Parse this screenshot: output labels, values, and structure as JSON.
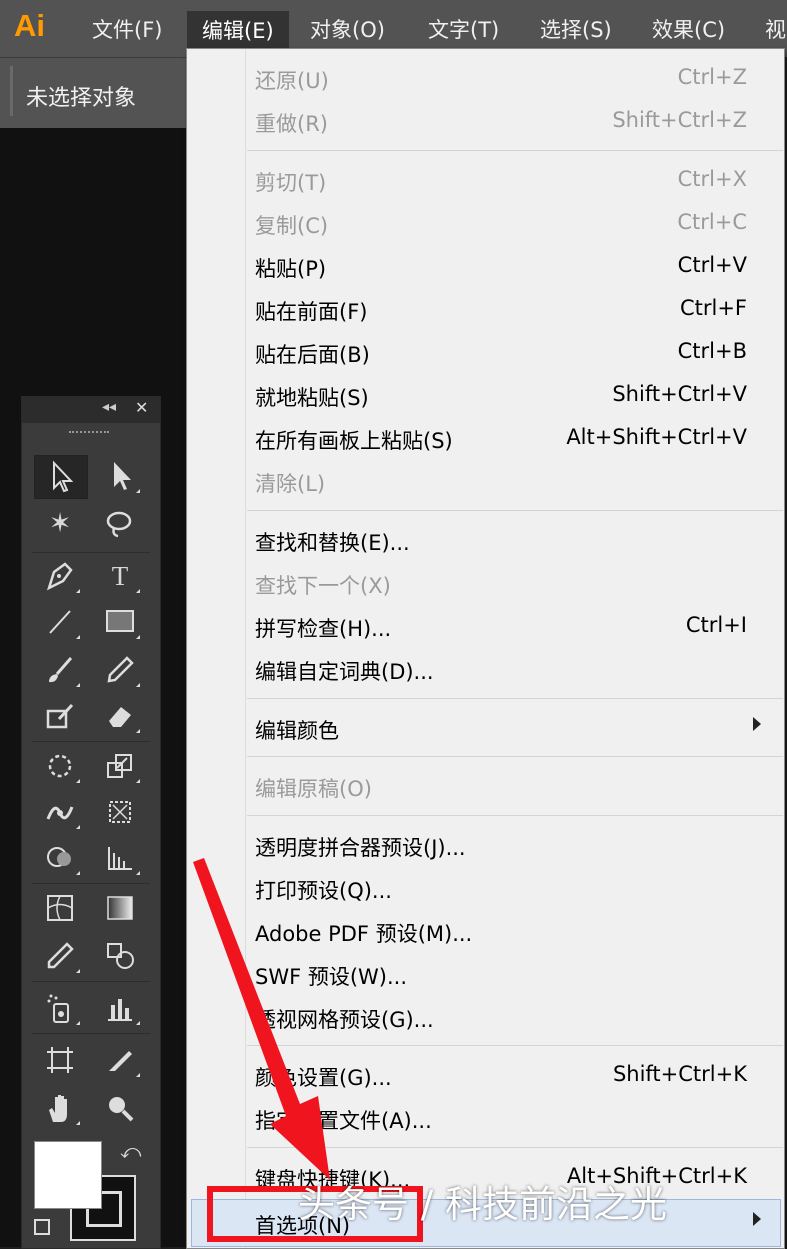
{
  "app": {
    "logo": "Ai"
  },
  "menubar": {
    "items": [
      "文件(F)",
      "编辑(E)",
      "对象(O)",
      "文字(T)",
      "选择(S)",
      "效果(C)",
      "视"
    ]
  },
  "control_bar": {
    "label": "未选择对象"
  },
  "tools_panel": {
    "collapse_glyph": "◂◂",
    "close_glyph": "✕"
  },
  "edit_menu": {
    "items": [
      {
        "label": "还原(U)",
        "shortcut": "Ctrl+Z",
        "disabled": true
      },
      {
        "label": "重做(R)",
        "shortcut": "Shift+Ctrl+Z",
        "disabled": true
      },
      {
        "label": "剪切(T)",
        "shortcut": "Ctrl+X",
        "disabled": true
      },
      {
        "label": "复制(C)",
        "shortcut": "Ctrl+C",
        "disabled": true
      },
      {
        "label": "粘贴(P)",
        "shortcut": "Ctrl+V",
        "disabled": false
      },
      {
        "label": "贴在前面(F)",
        "shortcut": "Ctrl+F",
        "disabled": false
      },
      {
        "label": "贴在后面(B)",
        "shortcut": "Ctrl+B",
        "disabled": false
      },
      {
        "label": "就地粘贴(S)",
        "shortcut": "Shift+Ctrl+V",
        "disabled": false
      },
      {
        "label": "在所有画板上粘贴(S)",
        "shortcut": "Alt+Shift+Ctrl+V",
        "disabled": false
      },
      {
        "label": "清除(L)",
        "shortcut": "",
        "disabled": true
      },
      {
        "label": "查找和替换(E)...",
        "shortcut": "",
        "disabled": false
      },
      {
        "label": "查找下一个(X)",
        "shortcut": "",
        "disabled": true
      },
      {
        "label": "拼写检查(H)...",
        "shortcut": "Ctrl+I",
        "disabled": false
      },
      {
        "label": "编辑自定词典(D)...",
        "shortcut": "",
        "disabled": false
      },
      {
        "label": "编辑颜色",
        "shortcut": "",
        "disabled": false,
        "submenu": true
      },
      {
        "label": "编辑原稿(O)",
        "shortcut": "",
        "disabled": true
      },
      {
        "label": "透明度拼合器预设(J)...",
        "shortcut": "",
        "disabled": false
      },
      {
        "label": "打印预设(Q)...",
        "shortcut": "",
        "disabled": false
      },
      {
        "label": "Adobe PDF 预设(M)...",
        "shortcut": "",
        "disabled": false
      },
      {
        "label": "SWF 预设(W)...",
        "shortcut": "",
        "disabled": false
      },
      {
        "label": "透视网格预设(G)...",
        "shortcut": "",
        "disabled": false
      },
      {
        "label": "颜色设置(G)...",
        "shortcut": "Shift+Ctrl+K",
        "disabled": false
      },
      {
        "label": "指定配置文件(A)...",
        "shortcut": "",
        "disabled": false
      },
      {
        "label": "键盘快捷键(K)...",
        "shortcut": "Alt+Shift+Ctrl+K",
        "disabled": false
      },
      {
        "label": "首选项(N)",
        "shortcut": "",
        "disabled": false,
        "submenu": true,
        "highlighted": true
      }
    ]
  },
  "annotation": {
    "watermark": "头条号 / 科技前沿之光",
    "arrow_color": "#f0141e",
    "box_color": "#f0141e"
  },
  "colors": {
    "menubar_bg": "#535353",
    "menu_bg": "#f0f0f0",
    "logo": "#ff9a00",
    "highlight": "#dbe6f5"
  }
}
